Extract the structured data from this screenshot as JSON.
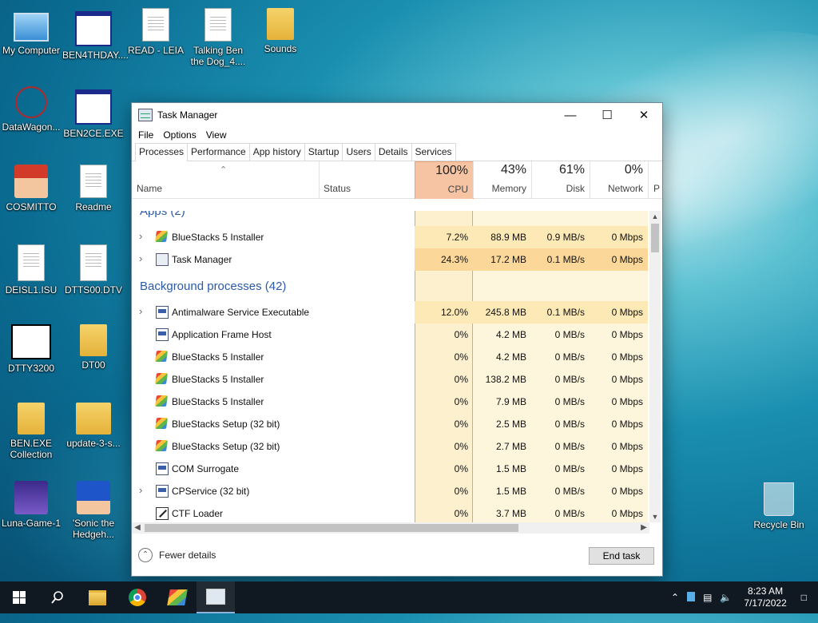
{
  "desktop": {
    "icons": [
      {
        "label": "My Computer"
      },
      {
        "label": "BEN4THDAY...."
      },
      {
        "label": "READ - LEIA"
      },
      {
        "label": "Talking Ben the Dog_4...."
      },
      {
        "label": "Sounds"
      },
      {
        "label": "DataWagon..."
      },
      {
        "label": "BEN2CE.EXE"
      },
      {
        "label": "COSMITTO"
      },
      {
        "label": "Readme"
      },
      {
        "label": "DEISL1.ISU"
      },
      {
        "label": "DTTS00.DTV"
      },
      {
        "label": "DTTY3200"
      },
      {
        "label": "DT00"
      },
      {
        "label": "BEN.EXE Collection"
      },
      {
        "label": "update-3-s..."
      },
      {
        "label": "Luna-Game-1"
      },
      {
        "label": "'Sonic the Hedgeh..."
      },
      {
        "label": "Recycle Bin"
      }
    ]
  },
  "window": {
    "title": "Task Manager",
    "controls": {
      "minimize": "—",
      "maximize": "☐",
      "close": "✕"
    },
    "menu": [
      "File",
      "Options",
      "View"
    ],
    "tabs": [
      "Processes",
      "Performance",
      "App history",
      "Startup",
      "Users",
      "Details",
      "Services"
    ],
    "active_tab": "Processes"
  },
  "columns": {
    "name": "Name",
    "status": "Status",
    "cpu": {
      "pct": "100%",
      "label": "CPU"
    },
    "memory": {
      "pct": "43%",
      "label": "Memory"
    },
    "disk": {
      "pct": "61%",
      "label": "Disk"
    },
    "network": {
      "pct": "0%",
      "label": "Network"
    },
    "extra": "P"
  },
  "groups": {
    "apps": "Apps (2)",
    "background": "Background processes (42)"
  },
  "apps": [
    {
      "name": "BlueStacks 5 Installer",
      "icon": "bluestacks-icon",
      "expandable": true,
      "cpu": "7.2%",
      "memory": "88.9 MB",
      "disk": "0.9 MB/s",
      "network": "0 Mbps"
    },
    {
      "name": "Task Manager",
      "icon": "task-manager-icon",
      "expandable": true,
      "cpu": "24.3%",
      "memory": "17.2 MB",
      "disk": "0.1 MB/s",
      "network": "0 Mbps"
    }
  ],
  "background": [
    {
      "name": "Antimalware Service Executable",
      "icon": "service-icon",
      "expandable": true,
      "cpu": "12.0%",
      "memory": "245.8 MB",
      "disk": "0.1 MB/s",
      "network": "0 Mbps"
    },
    {
      "name": "Application Frame Host",
      "icon": "service-icon",
      "expandable": false,
      "cpu": "0%",
      "memory": "4.2 MB",
      "disk": "0 MB/s",
      "network": "0 Mbps"
    },
    {
      "name": "BlueStacks 5 Installer",
      "icon": "bluestacks-icon",
      "expandable": false,
      "cpu": "0%",
      "memory": "4.2 MB",
      "disk": "0 MB/s",
      "network": "0 Mbps"
    },
    {
      "name": "BlueStacks 5 Installer",
      "icon": "bluestacks-icon",
      "expandable": false,
      "cpu": "0%",
      "memory": "138.2 MB",
      "disk": "0 MB/s",
      "network": "0 Mbps"
    },
    {
      "name": "BlueStacks 5 Installer",
      "icon": "bluestacks-icon",
      "expandable": false,
      "cpu": "0%",
      "memory": "7.9 MB",
      "disk": "0 MB/s",
      "network": "0 Mbps"
    },
    {
      "name": "BlueStacks Setup (32 bit)",
      "icon": "bluestacks-icon",
      "expandable": false,
      "cpu": "0%",
      "memory": "2.5 MB",
      "disk": "0 MB/s",
      "network": "0 Mbps"
    },
    {
      "name": "BlueStacks Setup (32 bit)",
      "icon": "bluestacks-icon",
      "expandable": false,
      "cpu": "0%",
      "memory": "2.7 MB",
      "disk": "0 MB/s",
      "network": "0 Mbps"
    },
    {
      "name": "COM Surrogate",
      "icon": "service-icon",
      "expandable": false,
      "cpu": "0%",
      "memory": "1.5 MB",
      "disk": "0 MB/s",
      "network": "0 Mbps"
    },
    {
      "name": "CPService (32 bit)",
      "icon": "service-icon",
      "expandable": true,
      "cpu": "0%",
      "memory": "1.5 MB",
      "disk": "0 MB/s",
      "network": "0 Mbps"
    },
    {
      "name": "CTF Loader",
      "icon": "ctf-loader-icon",
      "expandable": false,
      "cpu": "0%",
      "memory": "3.7 MB",
      "disk": "0 MB/s",
      "network": "0 Mbps"
    }
  ],
  "footer": {
    "fewer_details": "Fewer details",
    "end_task": "End task"
  },
  "taskbar": {
    "apps": [
      "start-icon",
      "search-icon",
      "file-explorer-icon",
      "chrome-icon",
      "bluestacks-icon",
      "task-manager-icon"
    ],
    "active_app": "task-manager-icon",
    "time": "8:23 AM",
    "date": "7/17/2022"
  },
  "colors": {
    "cpu_header": "#f7c4a3",
    "heat_low": "#fef6dc",
    "heat_mid": "#fde9b5",
    "heat_high": "#fbd89a",
    "group_text": "#2b5ba8",
    "taskbar": "#101822"
  }
}
